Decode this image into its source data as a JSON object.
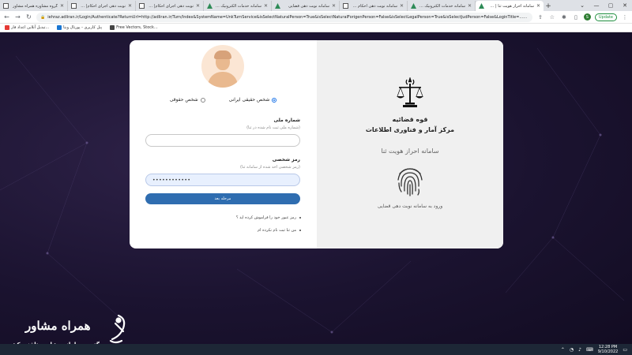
{
  "browser": {
    "tabs": [
      {
        "title": "گروه مشاوره همراه مشاور",
        "favicon": "doc"
      },
      {
        "title": "نوبت دهی اجرای احکام| ما...",
        "favicon": "doc"
      },
      {
        "title": "نوبت دهی اجرای احکام| ما...",
        "favicon": "doc"
      },
      {
        "title": "سامانه خدمات الکترونیک قـ...",
        "favicon": "green"
      },
      {
        "title": "سامانه نوبت دهی قضایی",
        "favicon": "green"
      },
      {
        "title": "سامانه نوبت دهی احکام ما...",
        "favicon": "doc"
      },
      {
        "title": "سامانه خدمات الکترونیک قـ...",
        "favicon": "green"
      },
      {
        "title": "سامانه احراز هویت ثنا | com",
        "favicon": "green",
        "active": true
      }
    ],
    "new_tab": "+",
    "url": "iehraz.adliran.ir/Login/Authenticate?ReturnUrl=http://adliran.ir/Turn/Index&SystemName=UnkTurnService&isSelectNaturalPerson=True&isSelectNaturalForigenPerson=False&isSelectLegalPerson=True&isSelectJudPerson=False&LoginTitle=...سامان...",
    "profile_initial": "S",
    "update_label": "Update"
  },
  "bookmarks": [
    {
      "label": "تبدیل آنلاین اعداد فار..."
    },
    {
      "label": "پنل کاربری - پورتال وبتا"
    },
    {
      "label": "Free Vectors, Stock..."
    }
  ],
  "login": {
    "person_types": [
      {
        "label": "شخص حقیقی ایرانی",
        "selected": true
      },
      {
        "label": "شخص حقوقی",
        "selected": false
      }
    ],
    "national_id": {
      "label": "شماره ملی",
      "hint": "(شماره ملی ثبت نام شده در ثنا)",
      "value": "",
      "placeholder": ""
    },
    "password": {
      "label": "رمز شخصی",
      "hint": "(رمز شخصی اخذ شده از سامانه ثنا)",
      "value": "••••••••••••"
    },
    "next_button": "مرحله بعد",
    "links": [
      "رمز عبور خود را فراموش کرده اید ؟",
      "من ثنا ثبت نام نکرده ام"
    ]
  },
  "brand": {
    "org_name": "قوه قضائیه",
    "center_name": "مرکز آمار و فناوری اطلاعات",
    "system_name": "سامانه احراز هویت ثنا",
    "enter_text": "ورود به سامانه نوبت دهی قضایی",
    "emblem_icon": "judiciary-emblem-icon",
    "fingerprint_icon": "fingerprint-icon"
  },
  "watermark": {
    "brand": "همراه مشاور",
    "tagline": "بزرگترین سامانه مشاوره تلفنی کشور"
  },
  "taskbar": {
    "time": "12:28 PM",
    "date": "9/10/2022"
  },
  "colors": {
    "accent": "#2f6db0",
    "radio_selected": "#1a73e8",
    "page_background": "#1b1330"
  }
}
